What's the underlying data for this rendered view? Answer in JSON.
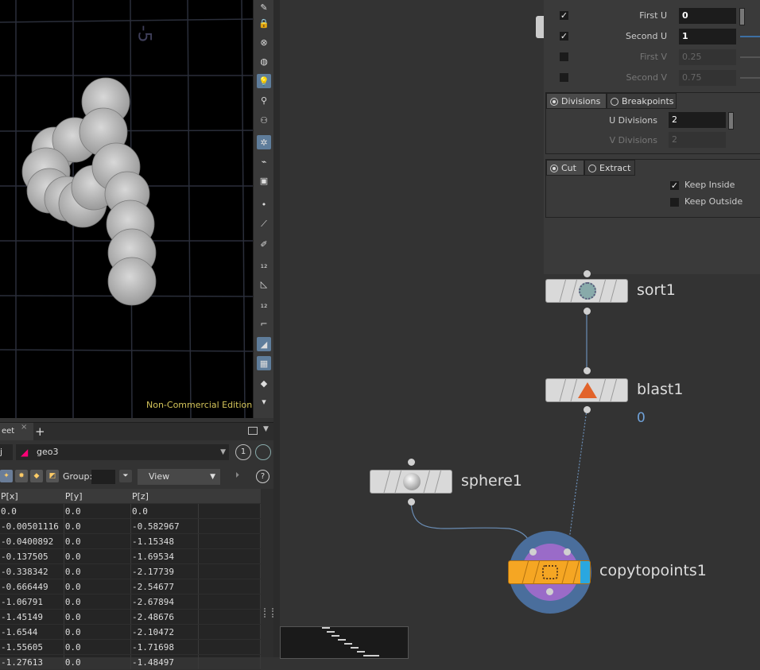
{
  "viewport": {
    "axis_label": "-5",
    "watermark": "Non-Commercial Edition"
  },
  "pane_tabs": {
    "active_tab": "eet",
    "close": "×",
    "add": "+"
  },
  "path": {
    "obj_fragment": "j",
    "node": "geo3",
    "pin_number": "1"
  },
  "filter": {
    "group_label": "Group:",
    "view_label": "View",
    "help": "?"
  },
  "spreadsheet": {
    "columns": [
      "P[x]",
      "P[y]",
      "P[z]"
    ],
    "rows": [
      [
        "0.0",
        "0.0",
        "0.0"
      ],
      [
        "-0.00501116",
        "0.0",
        "-0.582967"
      ],
      [
        "-0.0400892",
        "0.0",
        "-1.15348"
      ],
      [
        "-0.137505",
        "0.0",
        "-1.69534"
      ],
      [
        "-0.338342",
        "0.0",
        "-2.17739"
      ],
      [
        "-0.666449",
        "0.0",
        "-2.54677"
      ],
      [
        "-1.06791",
        "0.0",
        "-2.67894"
      ],
      [
        "-1.45149",
        "0.0",
        "-2.48676"
      ],
      [
        "-1.6544",
        "0.0",
        "-2.10472"
      ],
      [
        "-1.55605",
        "0.0",
        "-1.71698"
      ],
      [
        "-1.27613",
        "0.0",
        "-1.48497"
      ]
    ]
  },
  "params": {
    "first_u": {
      "label": "First U",
      "value": "0",
      "checked": true
    },
    "second_u": {
      "label": "Second U",
      "value": "1",
      "checked": true
    },
    "first_v": {
      "label": "First V",
      "value": "0.25",
      "checked": false
    },
    "second_v": {
      "label": "Second V",
      "value": "0.75",
      "checked": false
    },
    "div_tabs": {
      "divisions": "Divisions",
      "breakpoints": "Breakpoints"
    },
    "u_divisions": {
      "label": "U Divisions",
      "value": "2"
    },
    "v_divisions": {
      "label": "V Divisions",
      "value": "2"
    },
    "mode_tabs": {
      "cut": "Cut",
      "extract": "Extract"
    },
    "keep_inside": {
      "label": "Keep Inside",
      "checked": true
    },
    "keep_outside": {
      "label": "Keep Outside",
      "checked": false
    }
  },
  "network": {
    "nodes": {
      "sort": "sort1",
      "blast": "blast1",
      "blast_badge": "0",
      "sphere": "sphere1",
      "copy": "copytopoints1"
    }
  },
  "colors": {
    "accent_blue": "#5f7d9b",
    "watermark": "#d4c45a",
    "copy_node_orange": "#f5a623",
    "copy_node_purple": "#9a6bc8",
    "copy_node_ring": "#4a6e9c"
  }
}
